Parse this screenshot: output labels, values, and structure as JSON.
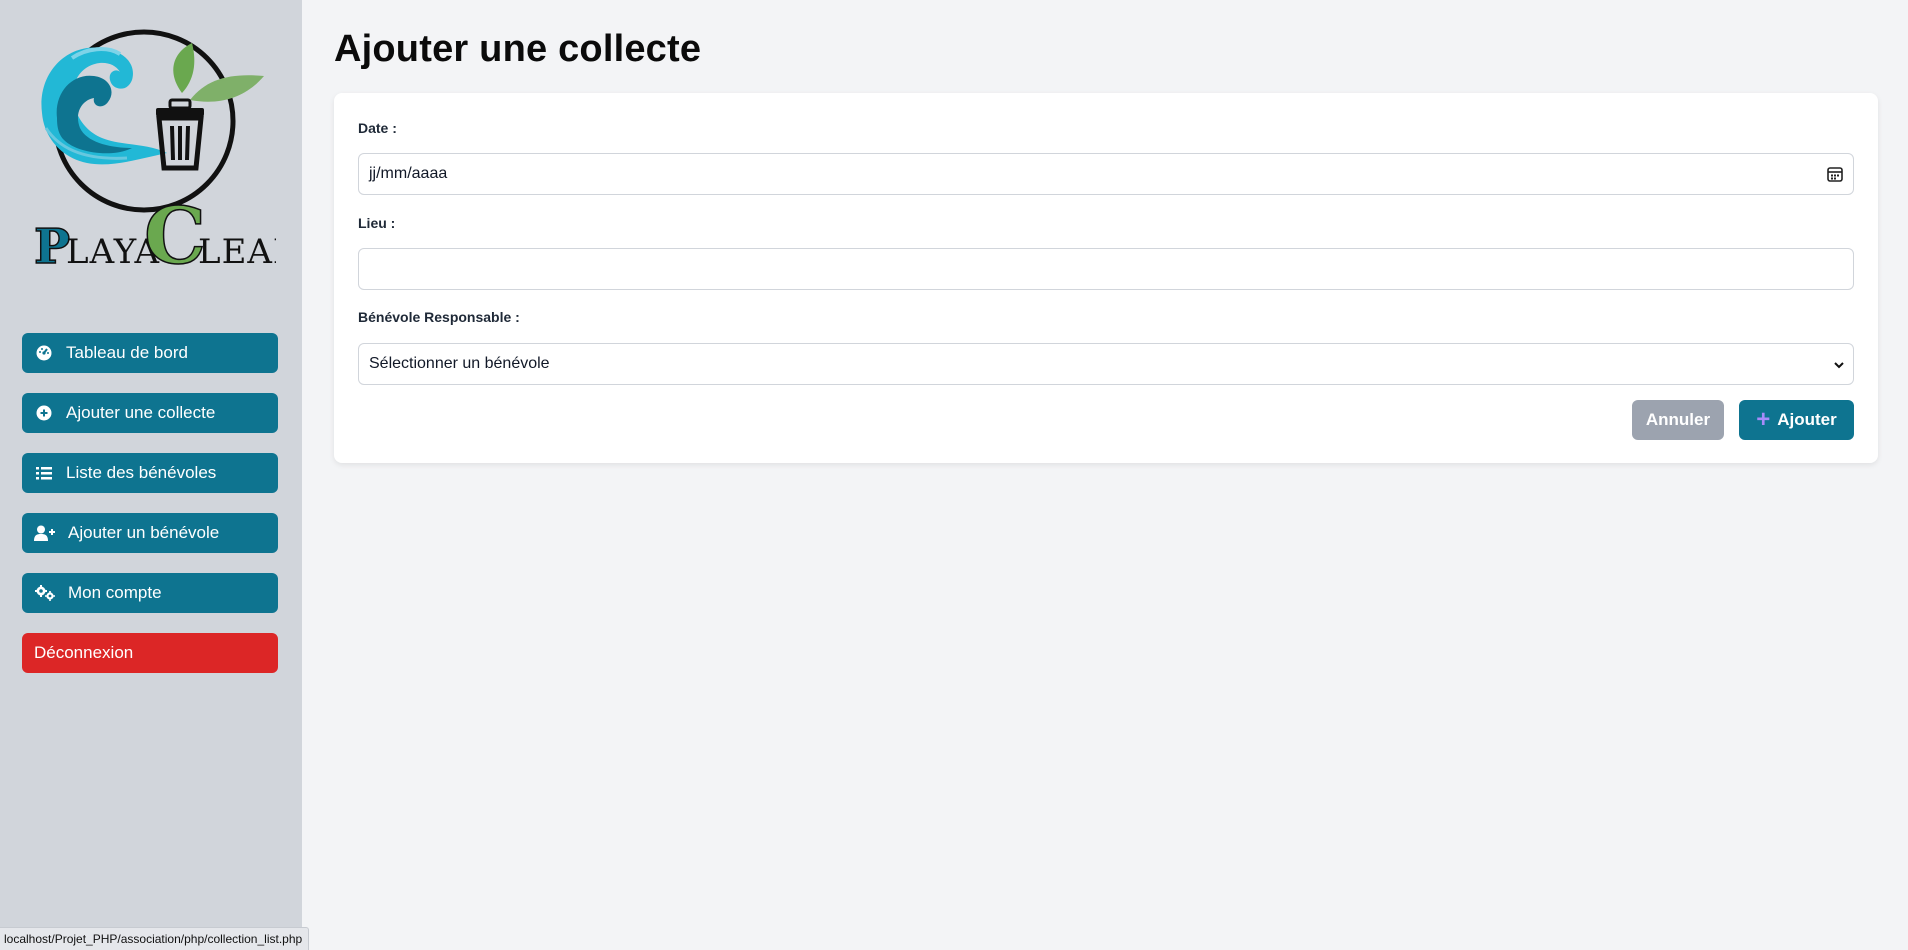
{
  "sidebar": {
    "logo": {
      "text_left": "PLAYA",
      "text_right": "LEAN",
      "big_c": "C"
    },
    "nav": [
      {
        "label": "Tableau de bord",
        "icon": "dashboard-icon"
      },
      {
        "label": "Ajouter une collecte",
        "icon": "plus-circle-icon"
      },
      {
        "label": "Liste des bénévoles",
        "icon": "list-icon"
      },
      {
        "label": "Ajouter un bénévole",
        "icon": "user-plus-icon"
      },
      {
        "label": "Mon compte",
        "icon": "gears-icon"
      }
    ],
    "logout_label": "Déconnexion"
  },
  "page": {
    "title": "Ajouter une collecte"
  },
  "form": {
    "date_label": "Date :",
    "date_placeholder": "jj/mm/aaaa",
    "lieu_label": "Lieu :",
    "lieu_value": "",
    "benevole_label": "Bénévole Responsable :",
    "benevole_selected": "Sélectionner un bénévole",
    "cancel_label": "Annuler",
    "add_label": "Ajouter"
  },
  "statusbar": {
    "url": "localhost/Projet_PHP/association/php/collection_list.php"
  },
  "colors": {
    "sidebar_bg": "#d1d5db",
    "primary": "#0e7490",
    "danger": "#dc2626",
    "cancel": "#9ca3af",
    "page_bg": "#f3f4f6"
  }
}
